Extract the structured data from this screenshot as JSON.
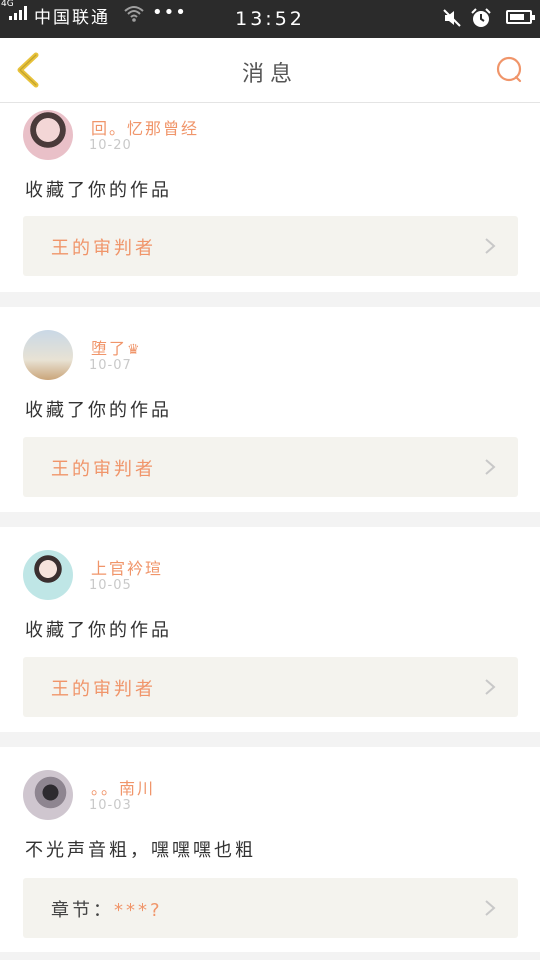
{
  "status_bar": {
    "network": "4G",
    "carrier": "中国联通",
    "more": "•••",
    "time": "13:52"
  },
  "navbar": {
    "title": "消息"
  },
  "messages": [
    {
      "username": "回。忆那曾经",
      "date": "10-20",
      "action": "收藏了你的作品",
      "reference_prefix": "",
      "reference": "王的审判者"
    },
    {
      "username": "堕了",
      "username_badge": "♛",
      "date": "10-07",
      "action": "收藏了你的作品",
      "reference_prefix": "",
      "reference": "王的审判者"
    },
    {
      "username": "上官衿瑄",
      "date": "10-05",
      "action": "收藏了你的作品",
      "reference_prefix": "",
      "reference": "王的审判者"
    },
    {
      "username": "。。南川",
      "date": "10-03",
      "action": "不光声音粗，嘿嘿嘿也粗",
      "reference_prefix": "章节：",
      "reference": "***?"
    }
  ],
  "colors": {
    "accent": "#f0956a",
    "nav_icon": "#e8c23a",
    "reference_bg": "#f4f3ee"
  },
  "icons": {
    "back": "chevron-left-icon",
    "search": "search-icon",
    "reference": "chevron-right-icon"
  }
}
